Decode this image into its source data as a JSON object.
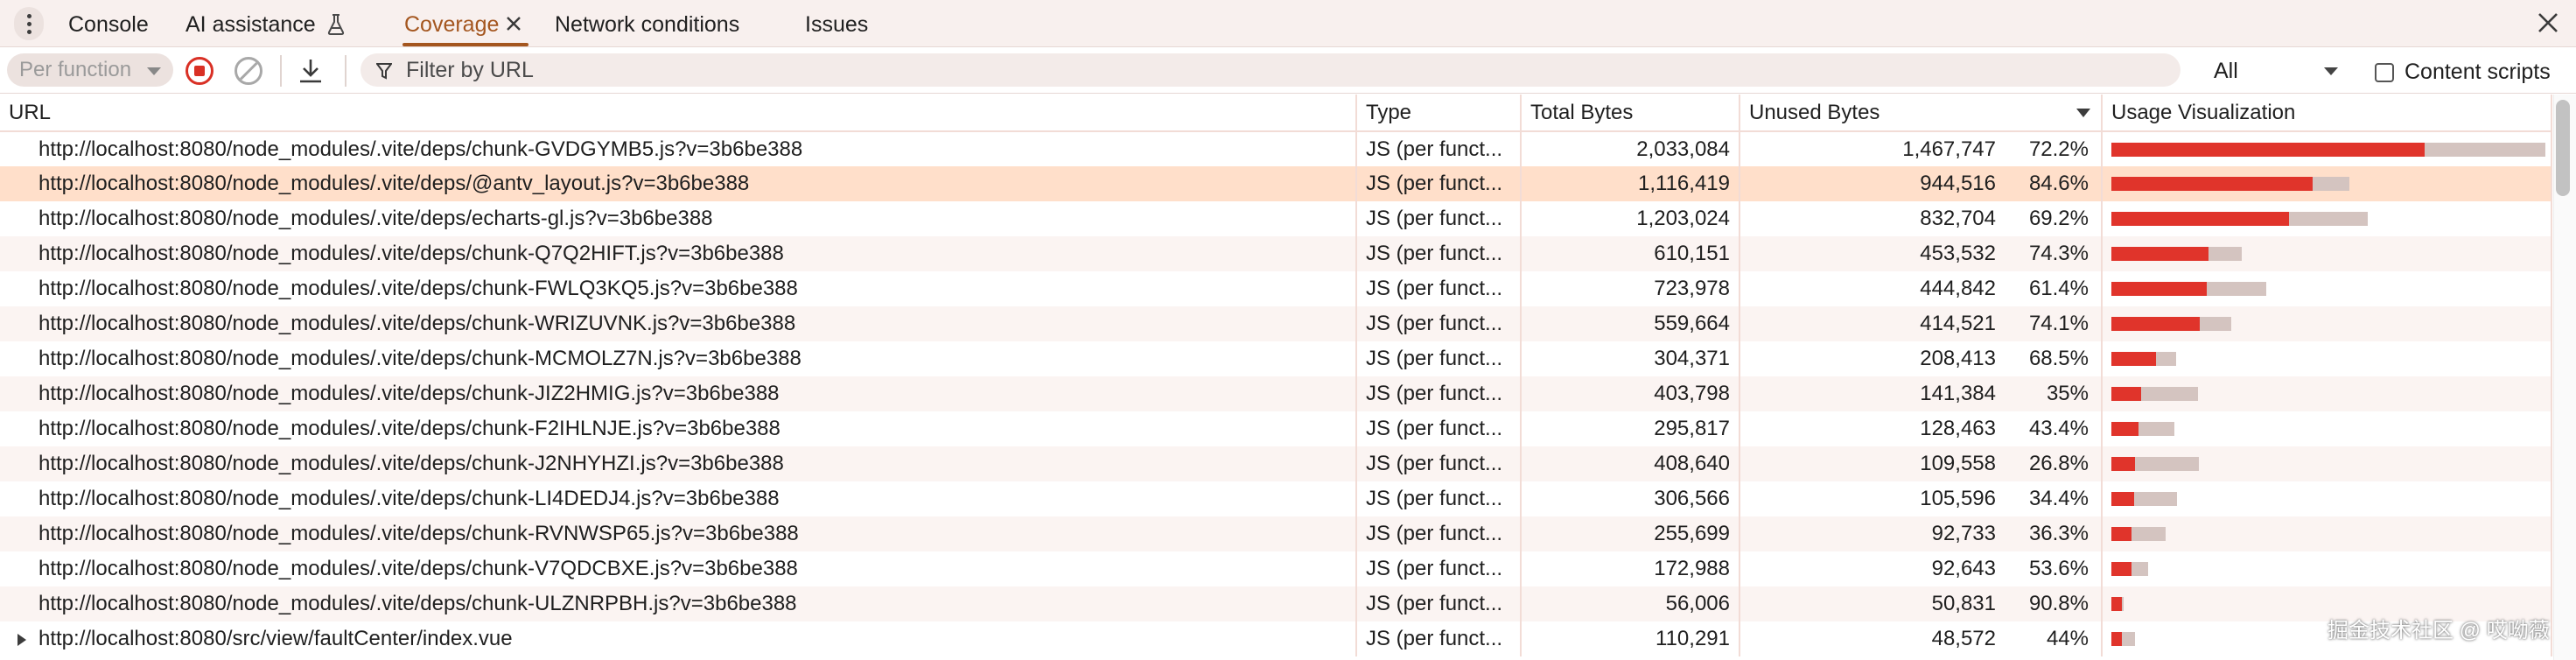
{
  "tabs": [
    {
      "label": "Console"
    },
    {
      "label": "AI assistance"
    },
    {
      "label": "Coverage"
    },
    {
      "label": "Network conditions"
    },
    {
      "label": "Issues"
    }
  ],
  "active_tab": "Coverage",
  "toolbar": {
    "mode_label": "Per function",
    "filter_placeholder": "Filter by URL",
    "filter_value": "",
    "type_filter": "All",
    "content_scripts_label": "Content scripts",
    "content_scripts_checked": false
  },
  "table": {
    "columns": [
      "URL",
      "Type",
      "Total Bytes",
      "Unused Bytes",
      "Usage Visualization"
    ],
    "sort_column": "Unused Bytes",
    "sort_direction": "descending",
    "max_total_bytes": 2033084,
    "rows": [
      {
        "url": "http://localhost:8080/node_modules/.vite/deps/chunk-GVDGYMB5.js?v=3b6be388",
        "type": "JS (per funct...",
        "total": "2,033,084",
        "unused": "1,467,747",
        "pct": "72.2%",
        "total_n": 2033084,
        "unused_n": 1467747
      },
      {
        "url": "http://localhost:8080/node_modules/.vite/deps/@antv_layout.js?v=3b6be388",
        "type": "JS (per funct...",
        "total": "1,116,419",
        "unused": "944,516",
        "pct": "84.6%",
        "total_n": 1116419,
        "unused_n": 944516,
        "selected": true
      },
      {
        "url": "http://localhost:8080/node_modules/.vite/deps/echarts-gl.js?v=3b6be388",
        "type": "JS (per funct...",
        "total": "1,203,024",
        "unused": "832,704",
        "pct": "69.2%",
        "total_n": 1203024,
        "unused_n": 832704
      },
      {
        "url": "http://localhost:8080/node_modules/.vite/deps/chunk-Q7Q2HIFT.js?v=3b6be388",
        "type": "JS (per funct...",
        "total": "610,151",
        "unused": "453,532",
        "pct": "74.3%",
        "total_n": 610151,
        "unused_n": 453532
      },
      {
        "url": "http://localhost:8080/node_modules/.vite/deps/chunk-FWLQ3KQ5.js?v=3b6be388",
        "type": "JS (per funct...",
        "total": "723,978",
        "unused": "444,842",
        "pct": "61.4%",
        "total_n": 723978,
        "unused_n": 444842
      },
      {
        "url": "http://localhost:8080/node_modules/.vite/deps/chunk-WRIZUVNK.js?v=3b6be388",
        "type": "JS (per funct...",
        "total": "559,664",
        "unused": "414,521",
        "pct": "74.1%",
        "total_n": 559664,
        "unused_n": 414521
      },
      {
        "url": "http://localhost:8080/node_modules/.vite/deps/chunk-MCMOLZ7N.js?v=3b6be388",
        "type": "JS (per funct...",
        "total": "304,371",
        "unused": "208,413",
        "pct": "68.5%",
        "total_n": 304371,
        "unused_n": 208413
      },
      {
        "url": "http://localhost:8080/node_modules/.vite/deps/chunk-JIZ2HMIG.js?v=3b6be388",
        "type": "JS (per funct...",
        "total": "403,798",
        "unused": "141,384",
        "pct": "35%",
        "total_n": 403798,
        "unused_n": 141384
      },
      {
        "url": "http://localhost:8080/node_modules/.vite/deps/chunk-F2IHLNJE.js?v=3b6be388",
        "type": "JS (per funct...",
        "total": "295,817",
        "unused": "128,463",
        "pct": "43.4%",
        "total_n": 295817,
        "unused_n": 128463
      },
      {
        "url": "http://localhost:8080/node_modules/.vite/deps/chunk-J2NHYHZI.js?v=3b6be388",
        "type": "JS (per funct...",
        "total": "408,640",
        "unused": "109,558",
        "pct": "26.8%",
        "total_n": 408640,
        "unused_n": 109558
      },
      {
        "url": "http://localhost:8080/node_modules/.vite/deps/chunk-LI4DEDJ4.js?v=3b6be388",
        "type": "JS (per funct...",
        "total": "306,566",
        "unused": "105,596",
        "pct": "34.4%",
        "total_n": 306566,
        "unused_n": 105596
      },
      {
        "url": "http://localhost:8080/node_modules/.vite/deps/chunk-RVNWSP65.js?v=3b6be388",
        "type": "JS (per funct...",
        "total": "255,699",
        "unused": "92,733",
        "pct": "36.3%",
        "total_n": 255699,
        "unused_n": 92733
      },
      {
        "url": "http://localhost:8080/node_modules/.vite/deps/chunk-V7QDCBXE.js?v=3b6be388",
        "type": "JS (per funct...",
        "total": "172,988",
        "unused": "92,643",
        "pct": "53.6%",
        "total_n": 172988,
        "unused_n": 92643
      },
      {
        "url": "http://localhost:8080/node_modules/.vite/deps/chunk-ULZNRPBH.js?v=3b6be388",
        "type": "JS (per funct...",
        "total": "56,006",
        "unused": "50,831",
        "pct": "90.8%",
        "total_n": 56006,
        "unused_n": 50831
      },
      {
        "url": "http://localhost:8080/src/view/faultCenter/index.vue",
        "type": "JS (per funct...",
        "total": "110,291",
        "unused": "48,572",
        "pct": "44%",
        "total_n": 110291,
        "unused_n": 48572,
        "expandable": true
      }
    ]
  },
  "colors": {
    "accent": "#a4561f",
    "record": "#d93025",
    "used_bar": "#e0342b",
    "unused_bar": "#d4c4c0",
    "selected_row": "#ffdfca"
  },
  "icons": {
    "more": "kebab-icon",
    "experiment": "flask-icon",
    "close_tab": "close-icon",
    "close_panel": "close-icon",
    "record": "record-stop-icon",
    "clear": "clear-icon",
    "export": "download-icon",
    "filter": "filter-icon"
  },
  "watermark": "掘金技术社区 @ 哎呦薇"
}
